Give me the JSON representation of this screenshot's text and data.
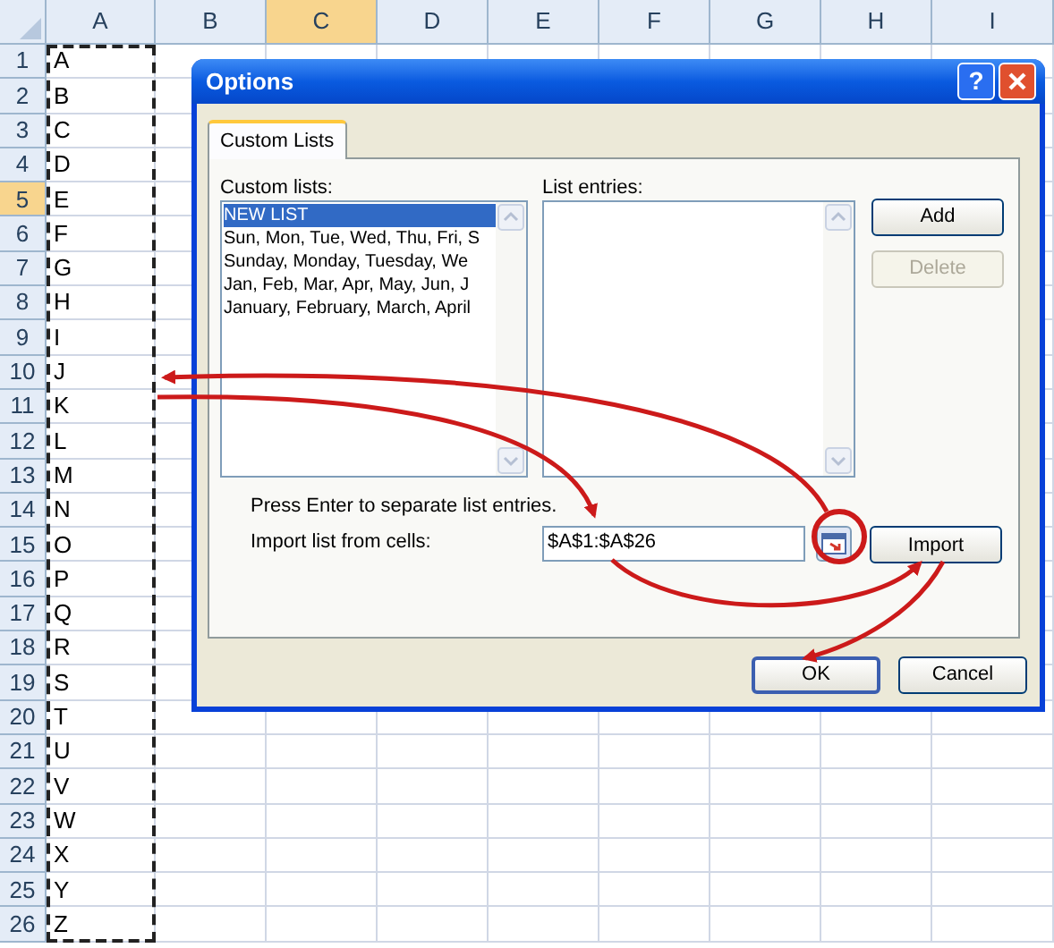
{
  "spreadsheet": {
    "columns": [
      {
        "label": "A",
        "selected": false
      },
      {
        "label": "B",
        "selected": false
      },
      {
        "label": "C",
        "selected": true
      },
      {
        "label": "D",
        "selected": false
      },
      {
        "label": "E",
        "selected": false
      },
      {
        "label": "F",
        "selected": false
      },
      {
        "label": "G",
        "selected": false
      },
      {
        "label": "H",
        "selected": false
      },
      {
        "label": "I",
        "selected": false
      }
    ],
    "rows": [
      {
        "number": "1",
        "selected": false,
        "cell": "A"
      },
      {
        "number": "2",
        "selected": false,
        "cell": "B"
      },
      {
        "number": "3",
        "selected": false,
        "cell": "C"
      },
      {
        "number": "4",
        "selected": false,
        "cell": "D"
      },
      {
        "number": "5",
        "selected": true,
        "cell": "E"
      },
      {
        "number": "6",
        "selected": false,
        "cell": "F"
      },
      {
        "number": "7",
        "selected": false,
        "cell": "G"
      },
      {
        "number": "8",
        "selected": false,
        "cell": "H"
      },
      {
        "number": "9",
        "selected": false,
        "cell": "I"
      },
      {
        "number": "10",
        "selected": false,
        "cell": "J"
      },
      {
        "number": "11",
        "selected": false,
        "cell": "K"
      },
      {
        "number": "12",
        "selected": false,
        "cell": "L"
      },
      {
        "number": "13",
        "selected": false,
        "cell": "M"
      },
      {
        "number": "14",
        "selected": false,
        "cell": "N"
      },
      {
        "number": "15",
        "selected": false,
        "cell": "O"
      },
      {
        "number": "16",
        "selected": false,
        "cell": "P"
      },
      {
        "number": "17",
        "selected": false,
        "cell": "Q"
      },
      {
        "number": "18",
        "selected": false,
        "cell": "R"
      },
      {
        "number": "19",
        "selected": false,
        "cell": "S"
      },
      {
        "number": "20",
        "selected": false,
        "cell": "T"
      },
      {
        "number": "21",
        "selected": false,
        "cell": "U"
      },
      {
        "number": "22",
        "selected": false,
        "cell": "V"
      },
      {
        "number": "23",
        "selected": false,
        "cell": "W"
      },
      {
        "number": "24",
        "selected": false,
        "cell": "X"
      },
      {
        "number": "25",
        "selected": false,
        "cell": "Y"
      },
      {
        "number": "26",
        "selected": false,
        "cell": "Z"
      }
    ]
  },
  "dialog": {
    "title": "Options",
    "help_button": "?",
    "tabs": [
      {
        "label": "Custom Lists",
        "selected": true
      }
    ],
    "custom_lists_label": "Custom lists:",
    "custom_lists": [
      {
        "label": "NEW LIST",
        "selected": true
      },
      {
        "label": "Sun, Mon, Tue, Wed, Thu, Fri, S",
        "selected": false
      },
      {
        "label": "Sunday, Monday, Tuesday, We",
        "selected": false
      },
      {
        "label": "Jan, Feb, Mar, Apr, May, Jun, J",
        "selected": false
      },
      {
        "label": "January, February, March, April",
        "selected": false
      }
    ],
    "list_entries_label": "List entries:",
    "side_buttons": [
      {
        "label": "Add",
        "disabled": false
      },
      {
        "label": "Delete",
        "disabled": true
      }
    ],
    "hint": "Press Enter to separate list entries.",
    "import_label": "Import list from cells:",
    "import_range": "$A$1:$A$26",
    "import_button": "Import",
    "footer_buttons": [
      {
        "label": "OK",
        "default": true
      },
      {
        "label": "Cancel",
        "default": false
      }
    ]
  }
}
